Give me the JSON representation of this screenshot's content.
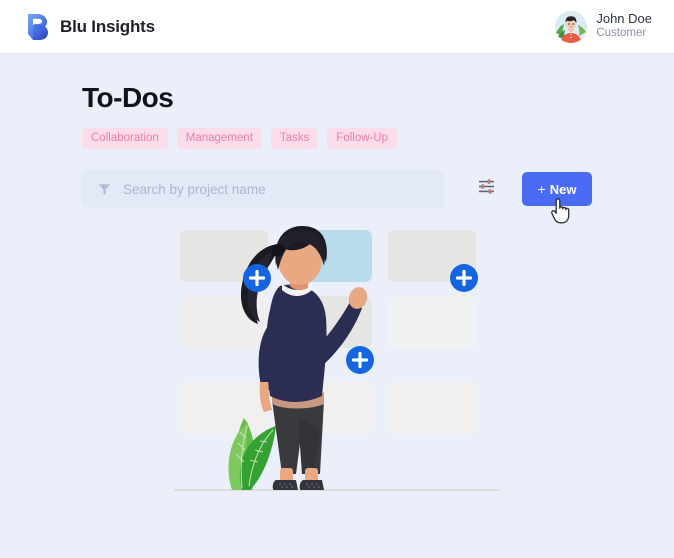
{
  "header": {
    "brand_name": "Blu Insights",
    "logo_icon": "blu-insights-logo",
    "user": {
      "name": "John Doe",
      "role": "Customer",
      "avatar_icon": "user-avatar-illustration"
    }
  },
  "main": {
    "page_title": "To-Dos",
    "tags": [
      {
        "label": "Collaboration"
      },
      {
        "label": "Management"
      },
      {
        "label": "Tasks"
      },
      {
        "label": "Follow-Up"
      }
    ],
    "toolbar": {
      "filter_icon": "filter-funnel-icon",
      "search_value": "",
      "search_placeholder": "Search by project name",
      "settings_icon": "sliders-settings-icon",
      "new_button_plus": "+",
      "new_button_label": "New",
      "cursor_icon": "pointing-hand-cursor"
    },
    "empty_state": {
      "illustration_name": "woman-adding-cards-to-board-illustration",
      "add_badge_label": "+",
      "add_badge_count": 3
    }
  },
  "colors": {
    "page_background": "#ebeffa",
    "header_background": "#ffffff",
    "accent_blue": "#4a6cf5",
    "badge_blue": "#1565e0",
    "tag_background": "#fbdcea",
    "tag_text": "#ea7fae",
    "search_background": "#e4e9f7",
    "title_text": "#111318",
    "highlight_card_blue": "#b8dcec"
  }
}
